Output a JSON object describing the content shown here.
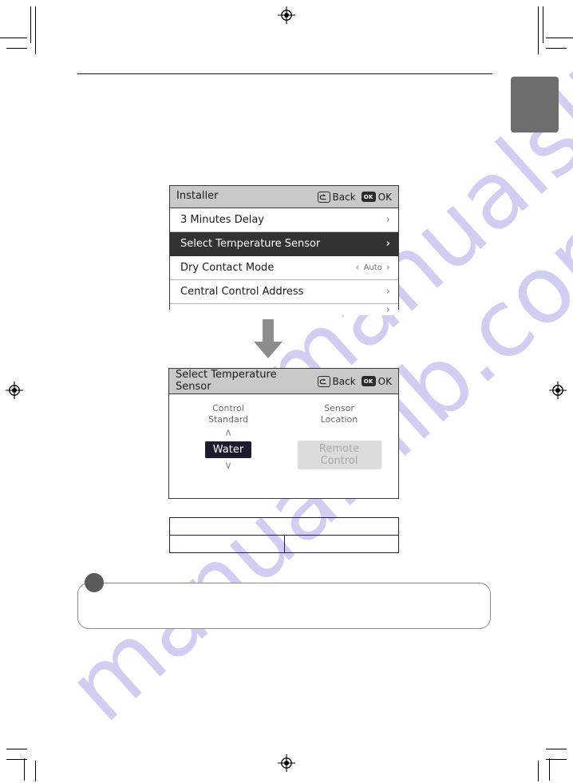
{
  "page": {
    "chapter_tab_color": "#6e6e6e",
    "watermark_text": "manualslib.com",
    "watermark_color": "#c9c7ef"
  },
  "panel1": {
    "title": "Installer",
    "back_label": "Back",
    "back_icon": "back-arrow-icon",
    "ok_label": "OK",
    "ok_icon": "ok-key-icon",
    "rows": [
      {
        "label": "3 Minutes Delay",
        "value": "",
        "chevron": "›",
        "selected": false
      },
      {
        "label": "Select Temperature Sensor",
        "value": "",
        "chevron": "›",
        "selected": true
      },
      {
        "label": "Dry Contact Mode",
        "value": "Auto",
        "left_chevron": "‹",
        "chevron": "›",
        "selected": false
      },
      {
        "label": "Central Control Address",
        "value": "",
        "chevron": "›",
        "selected": false
      },
      {
        "label": "",
        "value": "",
        "chevron": "›",
        "selected": false,
        "clipped": true
      }
    ]
  },
  "flow": {
    "arrow_icon": "arrow-down-icon",
    "arrow_color": "#8c8c8c"
  },
  "panel2": {
    "title": "Select Temperature Sensor",
    "back_label": "Back",
    "back_icon": "back-arrow-icon",
    "ok_label": "OK",
    "ok_icon": "ok-key-icon",
    "columns": [
      {
        "heading_line1": "Control",
        "heading_line2": "Standard",
        "up_icon": "chevron-up-icon",
        "down_icon": "chevron-down-icon",
        "option": "Water",
        "state": "selected"
      },
      {
        "heading_line1": "Sensor",
        "heading_line2": "Location",
        "option": "Remote Control",
        "state": "disabled"
      }
    ]
  },
  "table": {
    "rows": [
      [
        ""
      ],
      [
        "",
        ""
      ]
    ]
  },
  "note": {
    "text": ""
  }
}
